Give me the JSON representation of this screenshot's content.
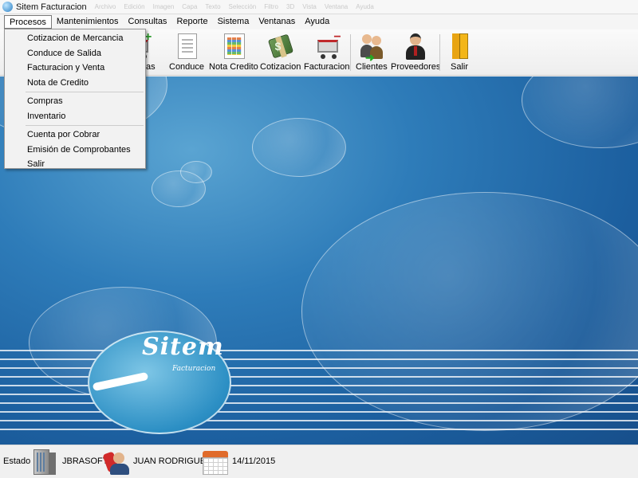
{
  "window": {
    "title": "Sitem Facturacion"
  },
  "ghost_menu": [
    "Archivo",
    "Edición",
    "Imagen",
    "Capa",
    "Texto",
    "Selección",
    "Filtro",
    "3D",
    "Vista",
    "Ventana",
    "Ayuda"
  ],
  "menubar": {
    "items": [
      {
        "label": "Procesos",
        "active": true
      },
      {
        "label": "Mantenimientos"
      },
      {
        "label": "Consultas"
      },
      {
        "label": "Reporte"
      },
      {
        "label": "Sistema"
      },
      {
        "label": "Ventanas"
      },
      {
        "label": "Ayuda"
      }
    ]
  },
  "dropdown": {
    "items": [
      "Cotizacion de Mercancia",
      "Conduce de Salida",
      "Facturacion y Venta",
      "Nota de Credito",
      "Compras",
      "Inventario",
      "Cuenta por Cobrar",
      "Emisión de Comprobantes",
      "Salir"
    ]
  },
  "toolbar": {
    "compras": "Compras",
    "conduce": "Conduce",
    "nota_credito": "Nota Credito",
    "cotizacion": "Cotizacion",
    "facturacion": "Facturacion",
    "clientes": "Clientes",
    "proveedores": "Proveedores",
    "salir": "Salir"
  },
  "logo": {
    "name": "Sitem",
    "subtitle": "Facturacion"
  },
  "status": {
    "label": "Estado",
    "company": "JBRASOFT",
    "user": "JUAN RODRIGUEZ",
    "date": "14/11/2015"
  },
  "icons": {
    "compras": "cart-plus-icon",
    "conduce": "document-icon",
    "nota_credito": "spreadsheet-icon",
    "cotizacion": "money-icon",
    "facturacion": "cart-icon",
    "clientes": "clients-icon",
    "proveedores": "supplier-icon",
    "salir": "exit-door-icon",
    "company": "building-icon",
    "user": "operator-icon",
    "date": "calendar-icon"
  }
}
